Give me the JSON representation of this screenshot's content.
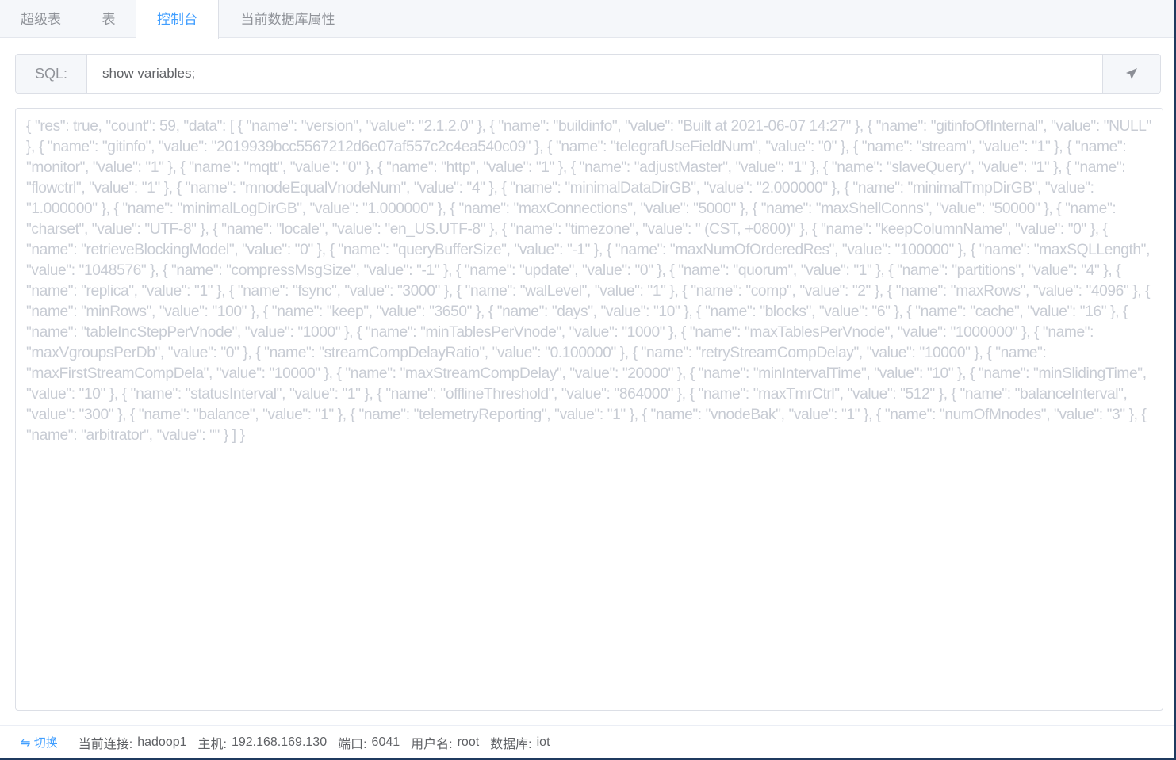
{
  "tabs": [
    {
      "label": "超级表",
      "active": false
    },
    {
      "label": "表",
      "active": false
    },
    {
      "label": "控制台",
      "active": true
    },
    {
      "label": "当前数据库属性",
      "active": false
    }
  ],
  "sql": {
    "label": "SQL:",
    "value": "show variables;",
    "send_icon": "paper-plane-icon"
  },
  "result_text": "{ \"res\": true, \"count\": 59, \"data\": [ { \"name\": \"version\", \"value\": \"2.1.2.0\" }, { \"name\": \"buildinfo\", \"value\": \"Built at 2021-06-07 14:27\" }, { \"name\": \"gitinfoOfInternal\", \"value\": \"NULL\" }, { \"name\": \"gitinfo\", \"value\": \"2019939bcc5567212d6e07af557c2c4ea540c09\" }, { \"name\": \"telegrafUseFieldNum\", \"value\": \"0\" }, { \"name\": \"stream\", \"value\": \"1\" }, { \"name\": \"monitor\", \"value\": \"1\" }, { \"name\": \"mqtt\", \"value\": \"0\" }, { \"name\": \"http\", \"value\": \"1\" }, { \"name\": \"adjustMaster\", \"value\": \"1\" }, { \"name\": \"slaveQuery\", \"value\": \"1\" }, { \"name\": \"flowctrl\", \"value\": \"1\" }, { \"name\": \"mnodeEqualVnodeNum\", \"value\": \"4\" }, { \"name\": \"minimalDataDirGB\", \"value\": \"2.000000\" }, { \"name\": \"minimalTmpDirGB\", \"value\": \"1.000000\" }, { \"name\": \"minimalLogDirGB\", \"value\": \"1.000000\" }, { \"name\": \"maxConnections\", \"value\": \"5000\" }, { \"name\": \"maxShellConns\", \"value\": \"50000\" }, { \"name\": \"charset\", \"value\": \"UTF-8\" }, { \"name\": \"locale\", \"value\": \"en_US.UTF-8\" }, { \"name\": \"timezone\", \"value\": \" (CST, +0800)\" }, { \"name\": \"keepColumnName\", \"value\": \"0\" }, { \"name\": \"retrieveBlockingModel\", \"value\": \"0\" }, { \"name\": \"queryBufferSize\", \"value\": \"-1\" }, { \"name\": \"maxNumOfOrderedRes\", \"value\": \"100000\" }, { \"name\": \"maxSQLLength\", \"value\": \"1048576\" }, { \"name\": \"compressMsgSize\", \"value\": \"-1\" }, { \"name\": \"update\", \"value\": \"0\" }, { \"name\": \"quorum\", \"value\": \"1\" }, { \"name\": \"partitions\", \"value\": \"4\" }, { \"name\": \"replica\", \"value\": \"1\" }, { \"name\": \"fsync\", \"value\": \"3000\" }, { \"name\": \"walLevel\", \"value\": \"1\" }, { \"name\": \"comp\", \"value\": \"2\" }, { \"name\": \"maxRows\", \"value\": \"4096\" }, { \"name\": \"minRows\", \"value\": \"100\" }, { \"name\": \"keep\", \"value\": \"3650\" }, { \"name\": \"days\", \"value\": \"10\" }, { \"name\": \"blocks\", \"value\": \"6\" }, { \"name\": \"cache\", \"value\": \"16\" }, { \"name\": \"tableIncStepPerVnode\", \"value\": \"1000\" }, { \"name\": \"minTablesPerVnode\", \"value\": \"1000\" }, { \"name\": \"maxTablesPerVnode\", \"value\": \"1000000\" }, { \"name\": \"maxVgroupsPerDb\", \"value\": \"0\" }, { \"name\": \"streamCompDelayRatio\", \"value\": \"0.100000\" }, { \"name\": \"retryStreamCompDelay\", \"value\": \"10000\" }, { \"name\": \"maxFirstStreamCompDela\", \"value\": \"10000\" }, { \"name\": \"maxStreamCompDelay\", \"value\": \"20000\" }, { \"name\": \"minIntervalTime\", \"value\": \"10\" }, { \"name\": \"minSlidingTime\", \"value\": \"10\" }, { \"name\": \"statusInterval\", \"value\": \"1\" }, { \"name\": \"offlineThreshold\", \"value\": \"864000\" }, { \"name\": \"maxTmrCtrl\", \"value\": \"512\" }, { \"name\": \"balanceInterval\", \"value\": \"300\" }, { \"name\": \"balance\", \"value\": \"1\" }, { \"name\": \"telemetryReporting\", \"value\": \"1\" }, { \"name\": \"vnodeBak\", \"value\": \"1\" }, { \"name\": \"numOfMnodes\", \"value\": \"3\" }, { \"name\": \"arbitrator\", \"value\": \"\" } ] }",
  "footer": {
    "switch_icon": "swap-arrows-icon",
    "switch_symbol": "⇋",
    "switch_label": "切换",
    "connection_label": "当前连接:",
    "connection": "hadoop1",
    "host_label": "主机:",
    "host": "192.168.169.130",
    "port_label": "端口:",
    "port": "6041",
    "user_label": "用户名:",
    "user": "root",
    "db_label": "数据库:",
    "db": "iot"
  },
  "colors": {
    "accent": "#409eff",
    "result_text": "#c8ccd4"
  }
}
